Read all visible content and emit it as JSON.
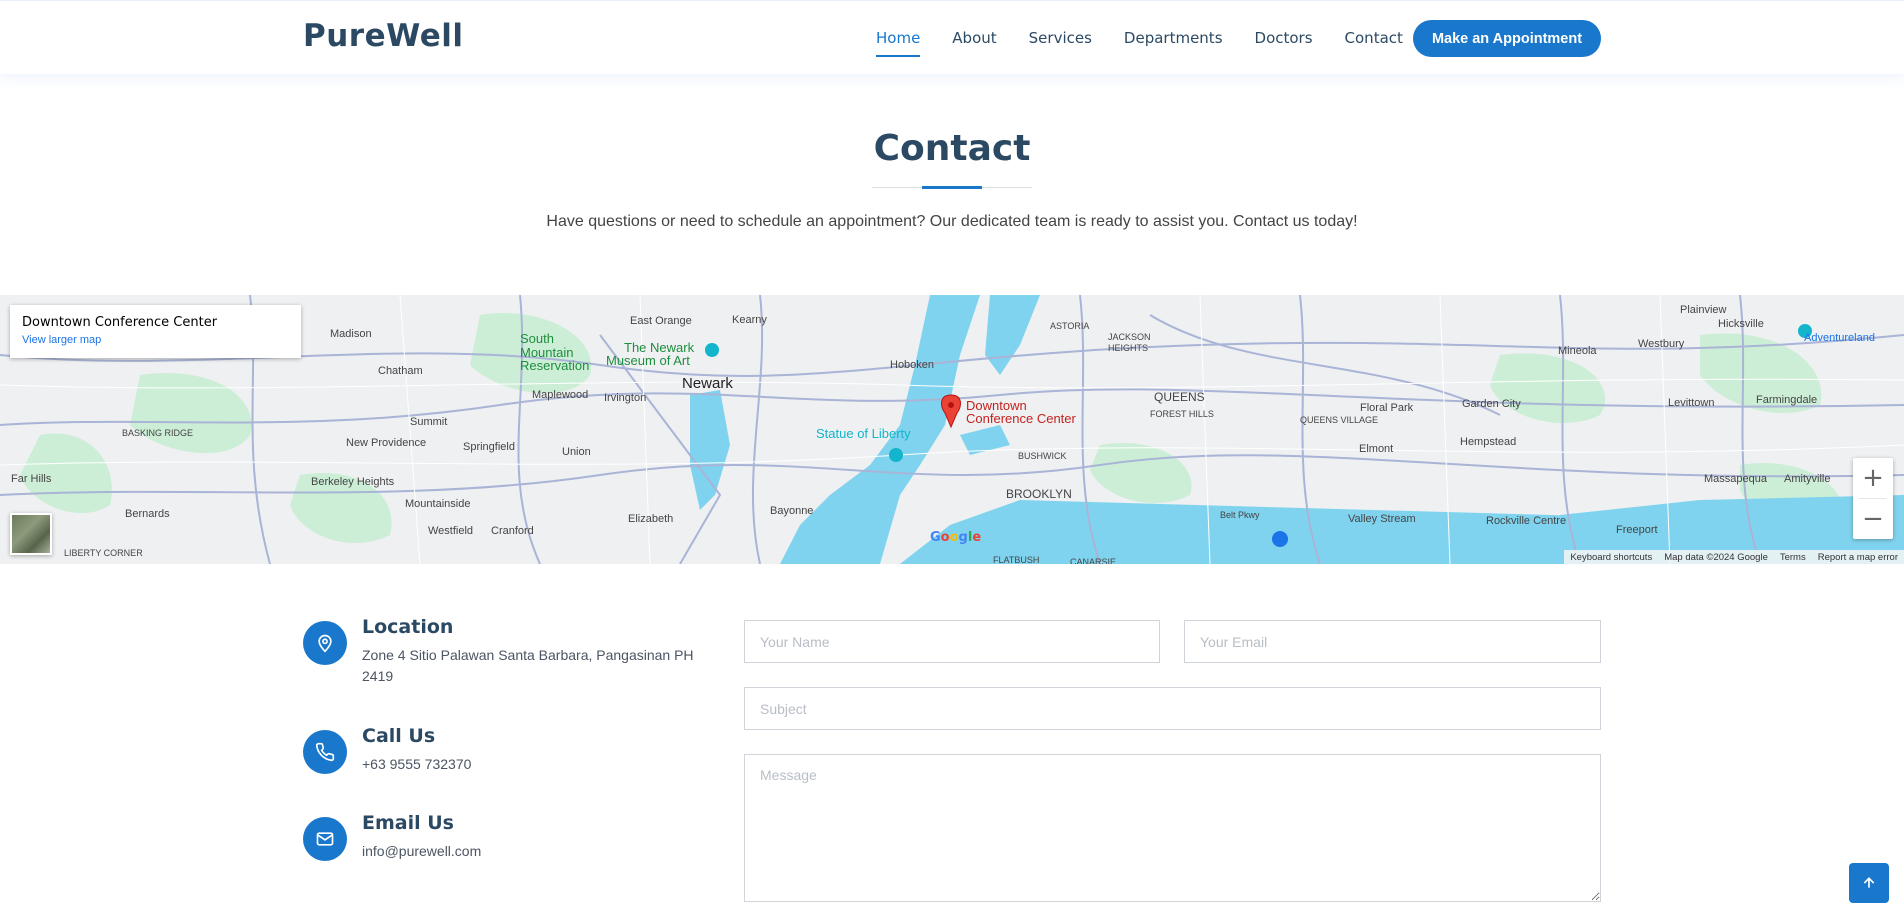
{
  "header": {
    "logo": "PureWell",
    "nav": [
      {
        "label": "Home",
        "active": true
      },
      {
        "label": "About"
      },
      {
        "label": "Services"
      },
      {
        "label": "Departments"
      },
      {
        "label": "Doctors"
      },
      {
        "label": "Contact"
      }
    ],
    "appointment_button": "Make an Appointment"
  },
  "section": {
    "title": "Contact",
    "subtitle": "Have questions or need to schedule an appointment? Our dedicated team is ready to assist you. Contact us today!"
  },
  "map": {
    "place_name": "Downtown Conference Center",
    "view_larger": "View larger map",
    "marker_label_line1": "Downtown",
    "marker_label_line2": "Conference Center",
    "zoom_in": "+",
    "zoom_out": "−",
    "labels": [
      "Madison",
      "South",
      "Mountain",
      "Reservation",
      "East Orange",
      "Kearny",
      "The Newark",
      "Museum of Art",
      "Newark",
      "Hoboken",
      "ASTORIA",
      "JACKSON",
      "HEIGHTS",
      "Plainview",
      "Hicksville",
      "Westbury",
      "Mineola",
      "Adventureland",
      "Chatham",
      "Maplewood",
      "Irvington",
      "QUEENS",
      "Floral Park",
      "Garden City",
      "Levittown",
      "Farmingdale",
      "Summit",
      "BASKING RIDGE",
      "New Providence",
      "Springfield",
      "Union",
      "Statue of Liberty",
      "FOREST HILLS",
      "QUEENS VILLAGE",
      "Hempstead",
      "Elmont",
      "Far Hills",
      "Berkeley Heights",
      "BUSHWICK",
      "Massapequa",
      "Amityville",
      "Bernards",
      "Mountainside",
      "Elizabeth",
      "Bayonne",
      "BROOKLYN",
      "Valley Stream",
      "Rockville Centre",
      "Freeport",
      "Westfield",
      "Cranford",
      "LIBERTY CORNER",
      "FLATBUSH",
      "CANARSIE",
      "Belt Pkwy"
    ],
    "footer": {
      "shortcuts": "Keyboard shortcuts",
      "data": "Map data ©2024 Google",
      "terms": "Terms",
      "report": "Report a map error"
    },
    "google": "Google"
  },
  "info": [
    {
      "title": "Location",
      "text": "Zone 4 Sitio Palawan Santa Barbara, Pangasinan PH 2419",
      "icon": "map-pin-icon"
    },
    {
      "title": "Call Us",
      "text": "+63 9555 732370",
      "icon": "phone-icon"
    },
    {
      "title": "Email Us",
      "text": "info@purewell.com",
      "icon": "envelope-icon"
    }
  ],
  "form": {
    "name_placeholder": "Your Name",
    "email_placeholder": "Your Email",
    "subject_placeholder": "Subject",
    "message_placeholder": "Message"
  },
  "colors": {
    "primary": "#1977cc",
    "heading": "#2c4964",
    "marker": "#ea4335",
    "water": "#7fd3ee",
    "park": "#c7ecd0"
  }
}
